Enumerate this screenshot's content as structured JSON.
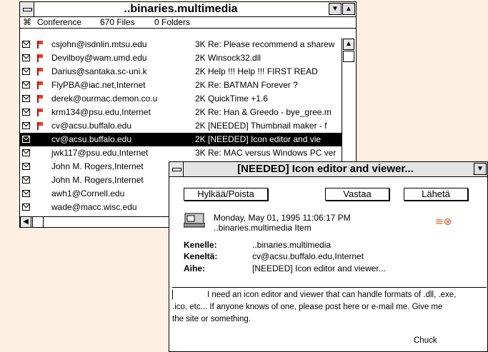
{
  "main_window": {
    "title": "..binaries.multimedia",
    "info": {
      "conference_label": "Conference",
      "files": "670 Files",
      "folders": "0 Folders"
    },
    "rows": [
      {
        "from": "csjohn@isdnlin.mtsu.edu",
        "size": "3K",
        "subject": "Re: Please recommend a sharew",
        "flagged": true,
        "selected": false
      },
      {
        "from": "Devilboy@wam.umd.edu",
        "size": "2K",
        "subject": "Winsock32.dll",
        "flagged": true,
        "selected": false
      },
      {
        "from": "Darius@santaka.sc-uni.k",
        "size": "2K",
        "subject": "Help !!! Help !!! FIRST READ",
        "flagged": true,
        "selected": false
      },
      {
        "from": "FlyPBA@iac.net,Internet",
        "size": "2K",
        "subject": "Re: BATMAN Forever ?",
        "flagged": true,
        "selected": false
      },
      {
        "from": "derek@ourmac.demon.co.u",
        "size": "2K",
        "subject": "QuickTime +1.6",
        "flagged": true,
        "selected": false
      },
      {
        "from": "krm134@psu.edu,Internet",
        "size": "2K",
        "subject": "Re: Han & Greedo - bye_gree.m",
        "flagged": true,
        "selected": false
      },
      {
        "from": "cv@acsu.buffalo.edu",
        "size": "2K",
        "subject": "[NEEDED] Thumbnail maker - f",
        "flagged": true,
        "selected": false
      },
      {
        "from": "cv@acsu.buffalo.edu",
        "size": "2K",
        "subject": "[NEEDED] Icon editor and vie",
        "flagged": false,
        "selected": true
      },
      {
        "from": "jwk117@psu.edu,Internet",
        "size": "3K",
        "subject": "Re: MAC versus Windows PC ver",
        "flagged": false,
        "selected": false
      },
      {
        "from": "John M. Rogers,Internet",
        "size": "",
        "subject": "",
        "flagged": false,
        "selected": false
      },
      {
        "from": "John M. Rogers,Internet",
        "size": "",
        "subject": "",
        "flagged": false,
        "selected": false
      },
      {
        "from": "awh1@Cornell.edu",
        "size": "",
        "subject": "",
        "flagged": false,
        "selected": false
      },
      {
        "from": "wade@macc.wisc.edu",
        "size": "",
        "subject": "",
        "flagged": false,
        "selected": false
      }
    ]
  },
  "message_window": {
    "title": "[NEEDED]  Icon editor and viewer...",
    "buttons": {
      "delete": "Hylkää/Poista",
      "reply": "Vastaa",
      "send": "Lähetä"
    },
    "date": "Monday, May 01, 1995 11:06:17 PM",
    "item": "..binaries.multimedia Item",
    "to_label": "Kenelle:",
    "to_value": "..binaries.multimedia",
    "from_label": "Keneltä:",
    "from_value": "cv@acsu.buffalo.edu,Internet",
    "subject_label": "Aihe:",
    "subject_value": "[NEEDED]  Icon editor and viewer...",
    "body_line1": "I need an icon editor and viewer that can handle formats of .dll, .exe,",
    "body_line2": ".ico, etc...  If anyone knows of one, please post here or e-mail me.  Give me",
    "body_line3": "the site or something.",
    "signature": "Chuck"
  },
  "colors": {
    "selection": "#000000",
    "flag": "#e04020",
    "desktop": "#fdf0e3"
  }
}
